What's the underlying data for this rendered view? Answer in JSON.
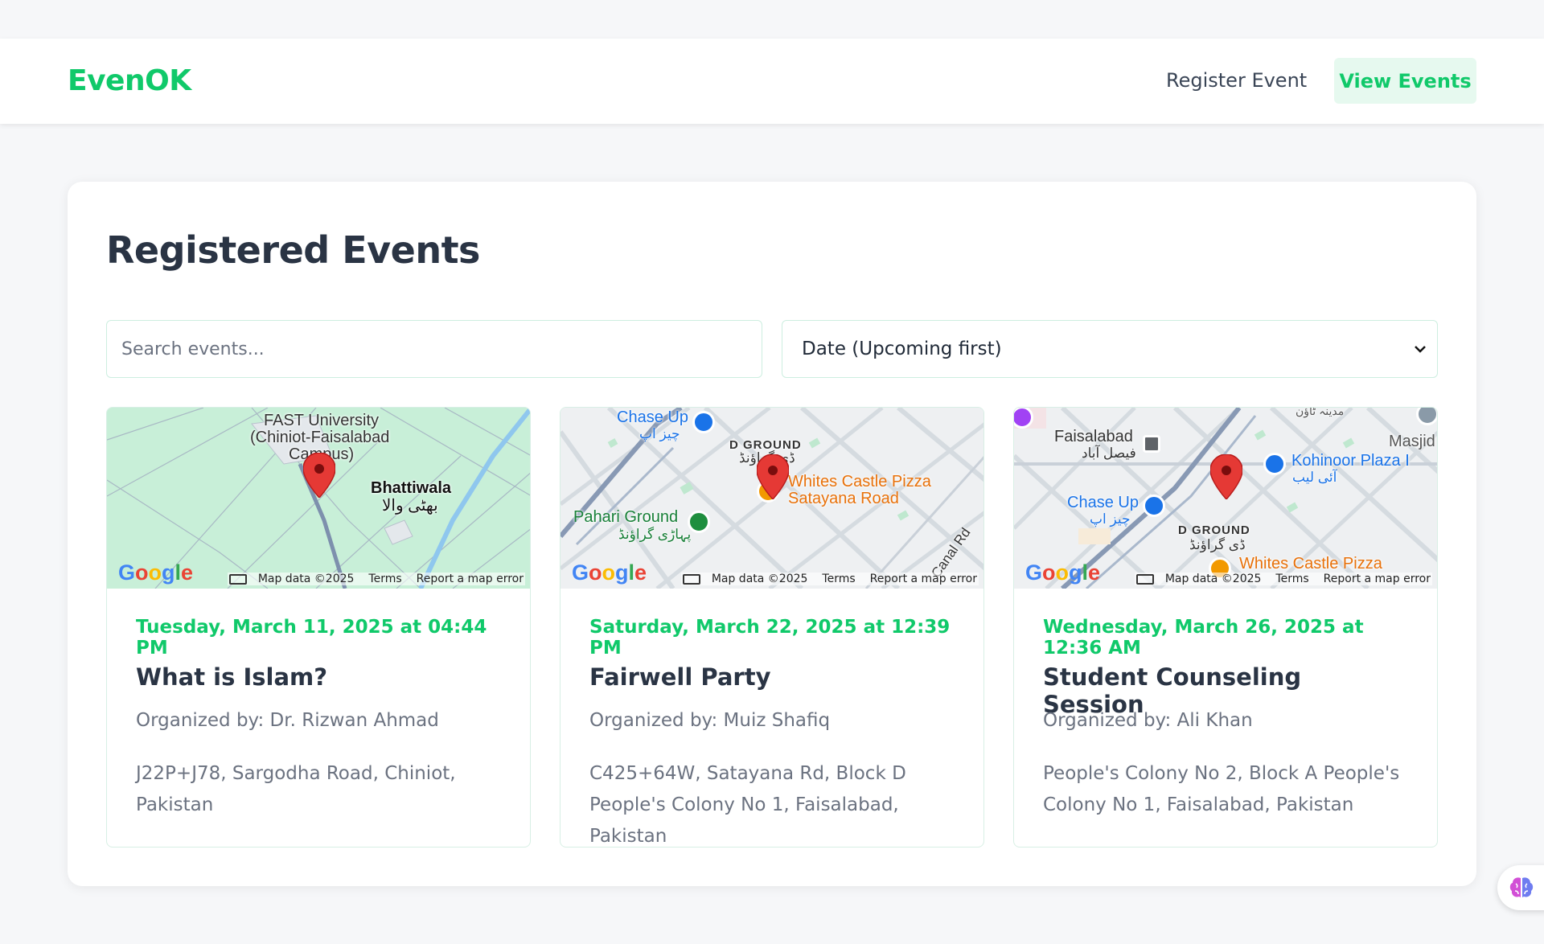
{
  "header": {
    "brand": "EvenOK",
    "nav": {
      "register": "Register Event",
      "view": "View Events"
    }
  },
  "main": {
    "title": "Registered Events",
    "search": {
      "placeholder": "Search events...",
      "value": ""
    },
    "sort": {
      "selected": "Date (Upcoming first)"
    }
  },
  "colors": {
    "accent": "#10c96a",
    "pin": "#e53935"
  },
  "map_footer": {
    "data": "Map data ©2025",
    "terms": "Terms",
    "report": "Report a map error"
  },
  "events": [
    {
      "date": "Tuesday, March 11, 2025 at 04:44 PM",
      "title": "What is Islam?",
      "organizer": "Organized by: Dr. Rizwan Ahmad",
      "address": "J22P+J78, Sargodha Road, Chiniot, Pakistan",
      "map_labels": {
        "place1": "FAST University",
        "place1b": "(Chiniot-Faisalabad",
        "place1c": "Campus)",
        "place2": "Bhattiwala",
        "place2u": "بھٹی والا"
      }
    },
    {
      "date": "Saturday, March 22, 2025 at 12:39 PM",
      "title": "Fairwell Party",
      "organizer": "Organized by: Muiz Shafiq",
      "address": "C425+64W, Satayana Rd, Block D People's Colony No 1, Faisalabad, Pakistan",
      "map_labels": {
        "chaseup": "Chase Up",
        "chaseup_u": "چیز اپ",
        "dground": "D GROUND",
        "dground_u": "ڈی گراؤنڈ",
        "pizza1": "Whites Castle Pizza",
        "pizza2": "Satayana Road",
        "pahari": "Pahari Ground",
        "pahari_u": "پہاڑی گراؤنڈ",
        "canal": "Canal Rd"
      }
    },
    {
      "date": "Wednesday, March 26, 2025 at 12:36 AM",
      "title": "Student Counseling Session",
      "organizer": "Organized by: Ali Khan",
      "address": "People's Colony No 2, Block A People's Colony No 1, Faisalabad, Pakistan",
      "map_labels": {
        "faisalabad": "Faisalabad",
        "faisalabad_u": "فیصل آباد",
        "kohinoor": "Kohinoor Plaza I",
        "kohinoor_u": "آئی لیب",
        "masjid": "Masjid",
        "chaseup": "Chase Up",
        "chaseup_u": "چیز اپ",
        "dground": "D GROUND",
        "dground_u": "ڈی گراؤنڈ",
        "pizza": "Whites Castle Pizza",
        "madina": "مدینہ ٹاؤن"
      }
    }
  ]
}
